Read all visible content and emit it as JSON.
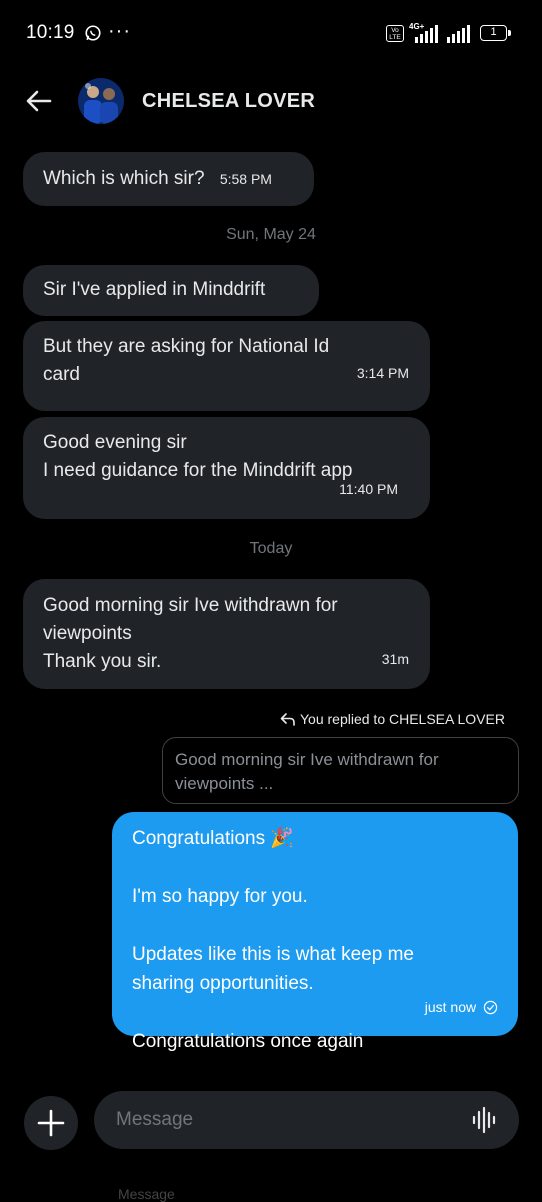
{
  "status_bar": {
    "time": "10:19",
    "network": "4G+",
    "volte": "Vo LTE",
    "battery": "1"
  },
  "header": {
    "title": "CHELSEA LOVER"
  },
  "messages": [
    {
      "text": "Which is which sir?",
      "time": "5:58 PM"
    },
    {
      "text": "Sir I've applied in Minddrift"
    },
    {
      "line1": "But they are asking for National Id",
      "line2": "card",
      "time": "3:14 PM"
    },
    {
      "line1": "Good evening sir",
      "line2": "I need guidance for the Minddrift app",
      "time": "11:40 PM"
    },
    {
      "line1": "Good morning sir Ive withdrawn for",
      "line2": "viewpoints",
      "line3": "Thank you sir.",
      "time": "31m"
    }
  ],
  "date_separators": [
    "Sun, May 24",
    "Today"
  ],
  "reply": {
    "label": "You replied to CHELSEA LOVER",
    "quote_line1": "Good morning sir Ive withdrawn for",
    "quote_line2": "viewpoints ..."
  },
  "my_message": {
    "line1": "Congratulations 🎉",
    "line2": "I'm so happy for you.",
    "line3": "Updates like this is what keep me",
    "line4": "sharing opportunities.",
    "line5": "Congratulations once again",
    "time": "just now"
  },
  "composer": {
    "placeholder": "Message",
    "ghost": "Message"
  },
  "colors": {
    "background": "#000000",
    "bubble_incoming": "#202327",
    "bubble_outgoing": "#1d9bf0",
    "muted": "#71767b"
  }
}
